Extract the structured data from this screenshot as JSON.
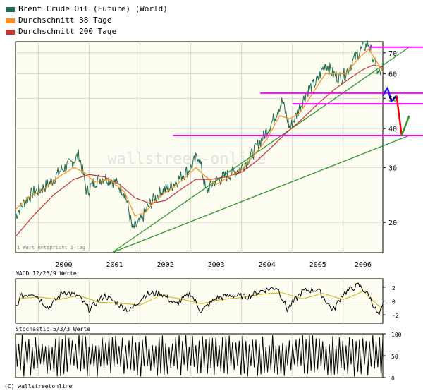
{
  "legend": {
    "items": [
      {
        "label": "Brent Crude Oil (Future) (World)",
        "color": "#1f6b4a"
      },
      {
        "label": "Durchschnitt 38 Tage",
        "color": "#ff8c1a"
      },
      {
        "label": "Durchschnitt 200 Tage",
        "color": "#c83232"
      }
    ]
  },
  "note": "1 Wert entspricht 1 Tag",
  "watermark": "wallstreet-online",
  "copyright": "(C) wallstreetonline",
  "colors": {
    "price": "#1f6b4a",
    "ma38": "#ff8c1a",
    "ma200": "#c83232",
    "trend": "#2a9a2a",
    "support": "#ff00ff",
    "forecast_down": "#1a1aff",
    "forecast_crash": "#ff0000",
    "forecast_up": "#2a9a2a",
    "panel_bg": "#fdfdf2",
    "grid": "#d8d8c8"
  },
  "chart_data": [
    {
      "type": "line",
      "title": "",
      "scale": "log",
      "ylim": [
        16,
        76
      ],
      "y_ticks": [
        20,
        30,
        40,
        50,
        60,
        70
      ],
      "x_range": [
        1999.55,
        2006.78
      ],
      "x_ticks": [
        "2000",
        "2001",
        "2002",
        "2003",
        "2004",
        "2005",
        "2006"
      ],
      "grid": true,
      "legend_position": "top-left",
      "series": [
        {
          "name": "Brent Crude Oil (Future) (World)",
          "points": [
            [
              1999.55,
              21
            ],
            [
              1999.7,
              23
            ],
            [
              1999.9,
              25
            ],
            [
              2000.05,
              25.5
            ],
            [
              2000.25,
              27
            ],
            [
              2000.45,
              29.5
            ],
            [
              2000.65,
              31
            ],
            [
              2000.8,
              33
            ],
            [
              2000.95,
              25
            ],
            [
              2001.1,
              27
            ],
            [
              2001.3,
              28
            ],
            [
              2001.5,
              27
            ],
            [
              2001.7,
              25
            ],
            [
              2001.85,
              19
            ],
            [
              2002.0,
              20
            ],
            [
              2002.2,
              23
            ],
            [
              2002.4,
              25
            ],
            [
              2002.6,
              26
            ],
            [
              2002.8,
              28
            ],
            [
              2003.0,
              30
            ],
            [
              2003.15,
              33
            ],
            [
              2003.3,
              25
            ],
            [
              2003.45,
              27
            ],
            [
              2003.65,
              28
            ],
            [
              2003.85,
              29
            ],
            [
              2004.0,
              30
            ],
            [
              2004.2,
              33
            ],
            [
              2004.4,
              37
            ],
            [
              2004.6,
              42
            ],
            [
              2004.8,
              49
            ],
            [
              2004.95,
              40
            ],
            [
              2005.1,
              45
            ],
            [
              2005.3,
              53
            ],
            [
              2005.5,
              57
            ],
            [
              2005.65,
              65
            ],
            [
              2005.8,
              60
            ],
            [
              2005.95,
              58
            ],
            [
              2006.1,
              62
            ],
            [
              2006.3,
              70
            ],
            [
              2006.4,
              73
            ],
            [
              2006.5,
              75
            ],
            [
              2006.58,
              68
            ],
            [
              2006.68,
              60
            ],
            [
              2006.78,
              61
            ]
          ]
        },
        {
          "name": "Durchschnitt 38 Tage",
          "points": [
            [
              1999.55,
              22
            ],
            [
              1999.8,
              24
            ],
            [
              2000.1,
              25.5
            ],
            [
              2000.4,
              28
            ],
            [
              2000.7,
              30
            ],
            [
              2000.9,
              29
            ],
            [
              2001.1,
              27
            ],
            [
              2001.4,
              27.5
            ],
            [
              2001.7,
              25
            ],
            [
              2001.9,
              21
            ],
            [
              2002.1,
              21.5
            ],
            [
              2002.35,
              24
            ],
            [
              2002.6,
              25.5
            ],
            [
              2002.85,
              27.5
            ],
            [
              2003.1,
              30
            ],
            [
              2003.3,
              28
            ],
            [
              2003.5,
              26.5
            ],
            [
              2003.75,
              28
            ],
            [
              2004.0,
              29.5
            ],
            [
              2004.25,
              33
            ],
            [
              2004.5,
              37
            ],
            [
              2004.75,
              44
            ],
            [
              2004.95,
              43
            ],
            [
              2005.15,
              45
            ],
            [
              2005.4,
              52
            ],
            [
              2005.65,
              60
            ],
            [
              2005.85,
              60
            ],
            [
              2006.05,
              60
            ],
            [
              2006.3,
              67
            ],
            [
              2006.5,
              72
            ],
            [
              2006.65,
              66
            ],
            [
              2006.78,
              61
            ]
          ]
        },
        {
          "name": "Durchschnitt 200 Tage",
          "points": [
            [
              1999.55,
              18
            ],
            [
              1999.9,
              21
            ],
            [
              2000.3,
              24.5
            ],
            [
              2000.7,
              27.5
            ],
            [
              2001.0,
              28.5
            ],
            [
              2001.3,
              28
            ],
            [
              2001.6,
              26.5
            ],
            [
              2001.9,
              24
            ],
            [
              2002.2,
              23
            ],
            [
              2002.5,
              23.5
            ],
            [
              2002.8,
              25.5
            ],
            [
              2003.1,
              27.5
            ],
            [
              2003.4,
              27.5
            ],
            [
              2003.7,
              28
            ],
            [
              2004.0,
              29
            ],
            [
              2004.3,
              31.5
            ],
            [
              2004.6,
              35
            ],
            [
              2004.9,
              39
            ],
            [
              2005.2,
              43
            ],
            [
              2005.5,
              48
            ],
            [
              2005.8,
              53
            ],
            [
              2006.1,
              57.5
            ],
            [
              2006.4,
              62
            ],
            [
              2006.6,
              64
            ],
            [
              2006.78,
              63
            ]
          ]
        }
      ],
      "support_levels": [
        {
          "y": 73,
          "x_start": 2006.5
        },
        {
          "y": 52,
          "x_start": 2004.37
        },
        {
          "y": 48,
          "x_start": 2005.0
        },
        {
          "y": 38,
          "x_start": 2002.65
        }
      ],
      "trend_lines": [
        {
          "points": [
            [
              2001.45,
              16
            ],
            [
              2007.3,
              73
            ]
          ]
        },
        {
          "points": [
            [
              2001.45,
              16
            ],
            [
              2007.3,
              38
            ]
          ]
        }
      ],
      "forecast_paths": [
        {
          "points": [
            [
              2006.78,
              51
            ],
            [
              2006.87,
              54
            ],
            [
              2006.95,
              49
            ],
            [
              2007.05,
              51
            ]
          ]
        },
        {
          "points": [
            [
              2007.05,
              51
            ],
            [
              2007.15,
              38
            ]
          ]
        },
        {
          "points": [
            [
              2007.15,
              38
            ],
            [
              2007.3,
              44
            ]
          ]
        }
      ]
    },
    {
      "type": "line",
      "title": "MACD 12/26/9 Werte",
      "ylim": [
        -3.2,
        3.2
      ],
      "y_ticks": [
        2,
        0,
        -2
      ],
      "x_range": [
        1999.55,
        2006.78
      ],
      "series": [
        {
          "name": "MACD",
          "points": [
            [
              1999.6,
              0.5
            ],
            [
              1999.9,
              1.2
            ],
            [
              2000.2,
              -1.0
            ],
            [
              2000.5,
              1.4
            ],
            [
              2000.8,
              0.6
            ],
            [
              2001.0,
              -1.2
            ],
            [
              2001.3,
              0.8
            ],
            [
              2001.6,
              -0.6
            ],
            [
              2001.8,
              -1.4
            ],
            [
              2002.1,
              0.9
            ],
            [
              2002.4,
              1.2
            ],
            [
              2002.7,
              -0.5
            ],
            [
              2003.0,
              1.1
            ],
            [
              2003.2,
              -1.5
            ],
            [
              2003.5,
              0.4
            ],
            [
              2003.8,
              0.8
            ],
            [
              2004.1,
              0.6
            ],
            [
              2004.4,
              1.5
            ],
            [
              2004.7,
              2.0
            ],
            [
              2004.9,
              -1.2
            ],
            [
              2005.2,
              1.4
            ],
            [
              2005.5,
              1.7
            ],
            [
              2005.8,
              -1.4
            ],
            [
              2006.0,
              1.1
            ],
            [
              2006.3,
              2.3
            ],
            [
              2006.5,
              0.9
            ],
            [
              2006.7,
              -2.2
            ],
            [
              2006.78,
              -0.8
            ]
          ]
        },
        {
          "name": "Signal",
          "points": [
            [
              1999.6,
              0.3
            ],
            [
              2000.0,
              0.6
            ],
            [
              2000.4,
              0.2
            ],
            [
              2000.8,
              0.8
            ],
            [
              2001.2,
              -0.2
            ],
            [
              2001.6,
              -0.3
            ],
            [
              2002.0,
              -0.6
            ],
            [
              2002.4,
              0.8
            ],
            [
              2002.8,
              0.3
            ],
            [
              2003.2,
              -0.4
            ],
            [
              2003.6,
              0.2
            ],
            [
              2004.0,
              0.5
            ],
            [
              2004.4,
              1.0
            ],
            [
              2004.8,
              1.2
            ],
            [
              2005.2,
              0.3
            ],
            [
              2005.6,
              1.1
            ],
            [
              2006.0,
              0.2
            ],
            [
              2006.4,
              1.4
            ],
            [
              2006.78,
              -1.3
            ]
          ]
        }
      ]
    },
    {
      "type": "line",
      "title": "Stochastic 5/3/3 Werte",
      "ylim": [
        0,
        100
      ],
      "y_ticks": [
        100,
        50,
        0
      ],
      "x_range": [
        1999.55,
        2006.78
      ],
      "series": [
        {
          "name": "Stochastic",
          "oscillations": 110
        }
      ]
    }
  ]
}
